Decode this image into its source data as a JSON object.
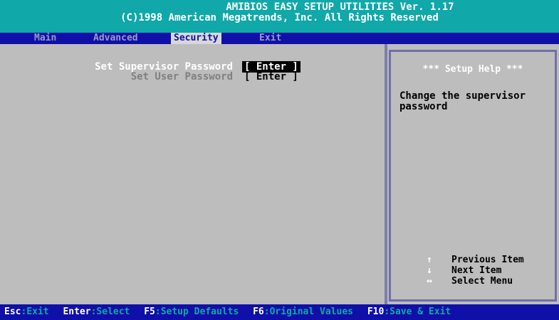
{
  "header": {
    "line1": "AMIBIOS EASY SETUP UTILITIES Ver. 1.17",
    "line2": "(C)1998 American Megatrends, Inc. All Rights Reserved"
  },
  "menu": {
    "main": "Main",
    "advanced": "Advanced",
    "security": "Security",
    "exit": "Exit"
  },
  "settings": {
    "supervisor": {
      "label": "Set Supervisor Password",
      "value": "[ Enter ]"
    },
    "user": {
      "label": "Set User Password",
      "value": "[ Enter ]"
    }
  },
  "help": {
    "title": "*** Setup Help ***",
    "text": "Change the supervisor password",
    "keys": [
      {
        "icon": "up-arrow-icon",
        "glyph": "↑",
        "label": "Previous Item"
      },
      {
        "icon": "down-arrow-icon",
        "glyph": "↓",
        "label": "Next Item"
      },
      {
        "icon": "left-right-arrow-icon",
        "glyph": "↔",
        "label": "Select Menu"
      }
    ]
  },
  "footer": [
    {
      "key": "Esc",
      "desc": ":Exit"
    },
    {
      "key": "Enter",
      "desc": ":Select"
    },
    {
      "key": "F5",
      "desc": ":Setup Defaults"
    },
    {
      "key": "F6",
      "desc": ":Original Values"
    },
    {
      "key": "F10",
      "desc": ":Save & Exit"
    }
  ],
  "colors": {
    "header_bg": "#10a8a8",
    "menubar_bg": "#1010a8",
    "content_bg": "#bdbdbd",
    "active_tab_bg": "#d8d8d8"
  }
}
